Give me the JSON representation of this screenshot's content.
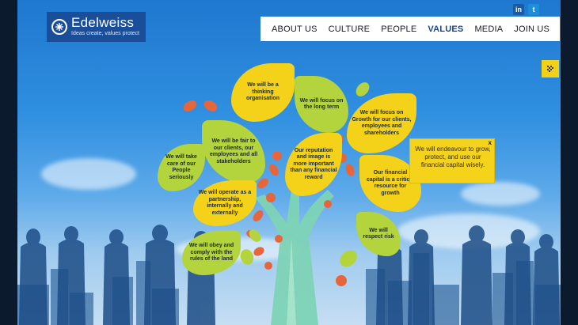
{
  "brand": {
    "name": "Edelweiss",
    "tagline": "Ideas create, values protect"
  },
  "social": {
    "linkedin": "in",
    "twitter": "t"
  },
  "nav": {
    "items": [
      {
        "label": "ABOUT US"
      },
      {
        "label": "CULTURE"
      },
      {
        "label": "PEOPLE"
      },
      {
        "label": "VALUES"
      },
      {
        "label": "MEDIA"
      },
      {
        "label": "JOIN US"
      }
    ],
    "active": "VALUES"
  },
  "values": {
    "thinking": "We will be a thinking organisation",
    "long_term": "We will focus on the long term",
    "growth": "We will focus on Growth for our clients, employees and shareholders",
    "fair": "We will be fair to our clients, our employees and all stakeholders",
    "people": "We will take care of our People seriously",
    "reputation": "Our reputation and image is more important than any financial reward",
    "capital": "Our financial capital is a critical resource for growth",
    "partnership": "We will operate as a partnership, internally and externally",
    "risk": "We will respect risk",
    "rules": "We will obey and comply with the rules of the land"
  },
  "popup": {
    "text": "We will endeavour to grow, protect, and use our financial capital wisely.",
    "close": "x"
  },
  "colors": {
    "leaf_yellow": "#f4d21a",
    "leaf_green": "#b3d43c",
    "trunk": "#7dd3b5",
    "brand_blue": "#1b4e98",
    "accent_orange": "#e7653a"
  }
}
